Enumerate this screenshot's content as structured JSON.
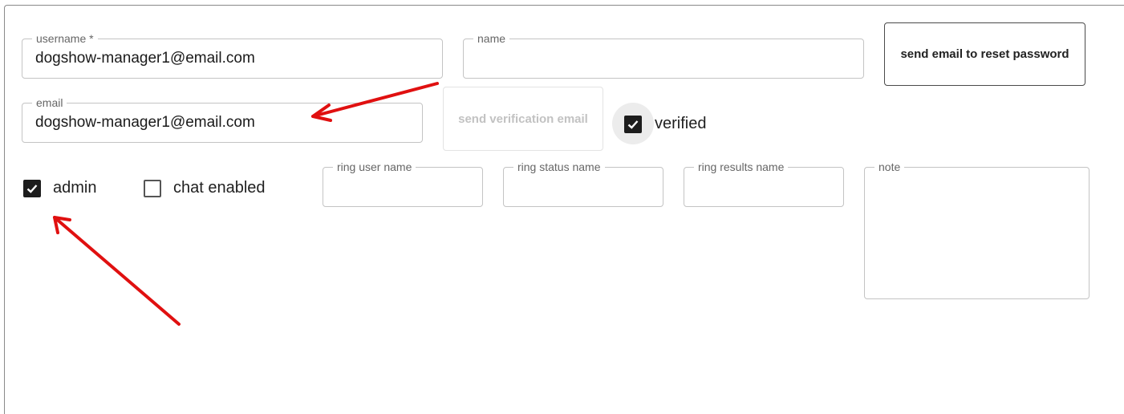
{
  "form": {
    "username": {
      "label": "username *",
      "value": "dogshow-manager1@email.com"
    },
    "name": {
      "label": "name",
      "value": ""
    },
    "reset_button": "send email to reset password",
    "email": {
      "label": "email",
      "value": "dogshow-manager1@email.com"
    },
    "verification_button": "send verification email",
    "verified": {
      "label": "verified",
      "checked": true
    },
    "admin": {
      "label": "admin",
      "checked": true
    },
    "chat_enabled": {
      "label": "chat enabled",
      "checked": false
    },
    "ring_user_name": {
      "label": "ring user name",
      "value": ""
    },
    "ring_status_name": {
      "label": "ring status name",
      "value": ""
    },
    "ring_results_name": {
      "label": "ring results name",
      "value": ""
    },
    "note": {
      "label": "note",
      "value": ""
    }
  },
  "colors": {
    "annotation_arrow": "#e01010",
    "checkbox_checked": "#1d1d1d"
  },
  "icons": {
    "check": "check-icon",
    "arrow": "annotation-arrow"
  }
}
